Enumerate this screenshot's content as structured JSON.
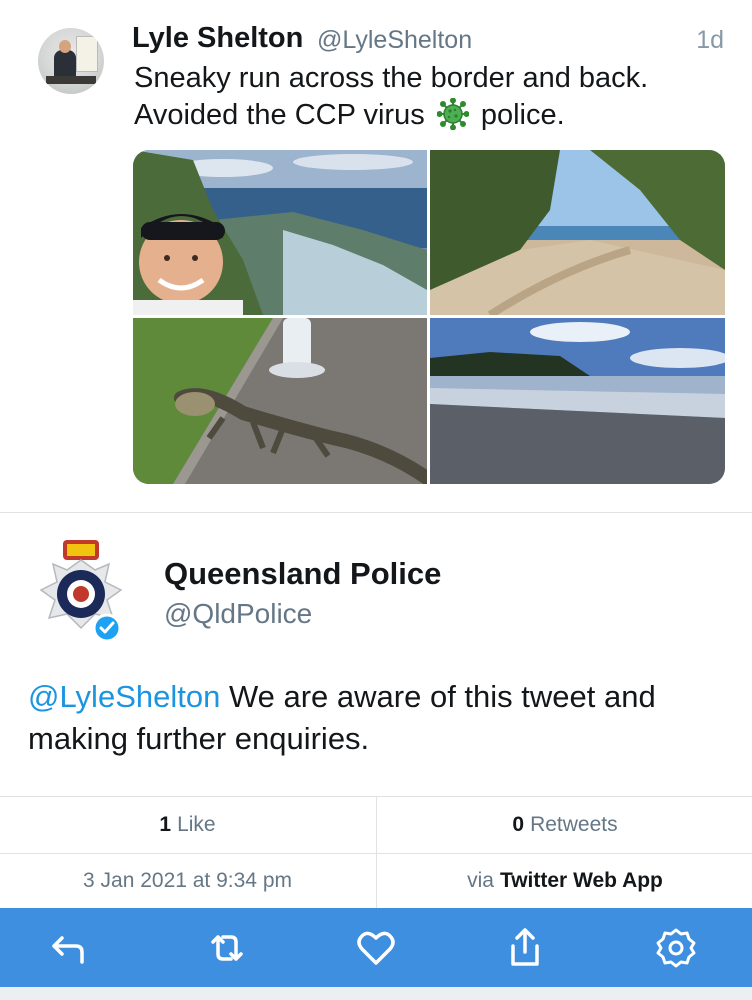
{
  "original_tweet": {
    "author_name": "Lyle Shelton",
    "author_handle": "@LyleShelton",
    "time": "1d",
    "text_line1": "Sneaky run across the border and back.",
    "text_line2_a": "Avoided the CCP virus",
    "text_line2_b": "police.",
    "emoji": "virus-icon",
    "photos": [
      "selfie-coast-photo",
      "beach-path-photo",
      "lizard-photo",
      "beach-shore-photo"
    ]
  },
  "reply_tweet": {
    "author_name": "Queensland Police",
    "author_handle": "@QldPolice",
    "verified": true,
    "mention": "@LyleShelton",
    "text": " We are aware of this tweet and making further enquiries."
  },
  "stats": {
    "likes_count": "1",
    "likes_label": "Like",
    "retweets_count": "0",
    "retweets_label": "Retweets"
  },
  "meta": {
    "timestamp": "3 Jan 2021 at 9:34 pm",
    "via_prefix": "via",
    "via_app": "Twitter Web App"
  },
  "toolbar": {
    "background": "#3f8fe0",
    "icons": [
      "reply-icon",
      "retweet-icon",
      "like-icon",
      "share-icon",
      "settings-icon"
    ]
  },
  "colors": {
    "link": "#1b95e0",
    "secondary_text": "#657786"
  }
}
